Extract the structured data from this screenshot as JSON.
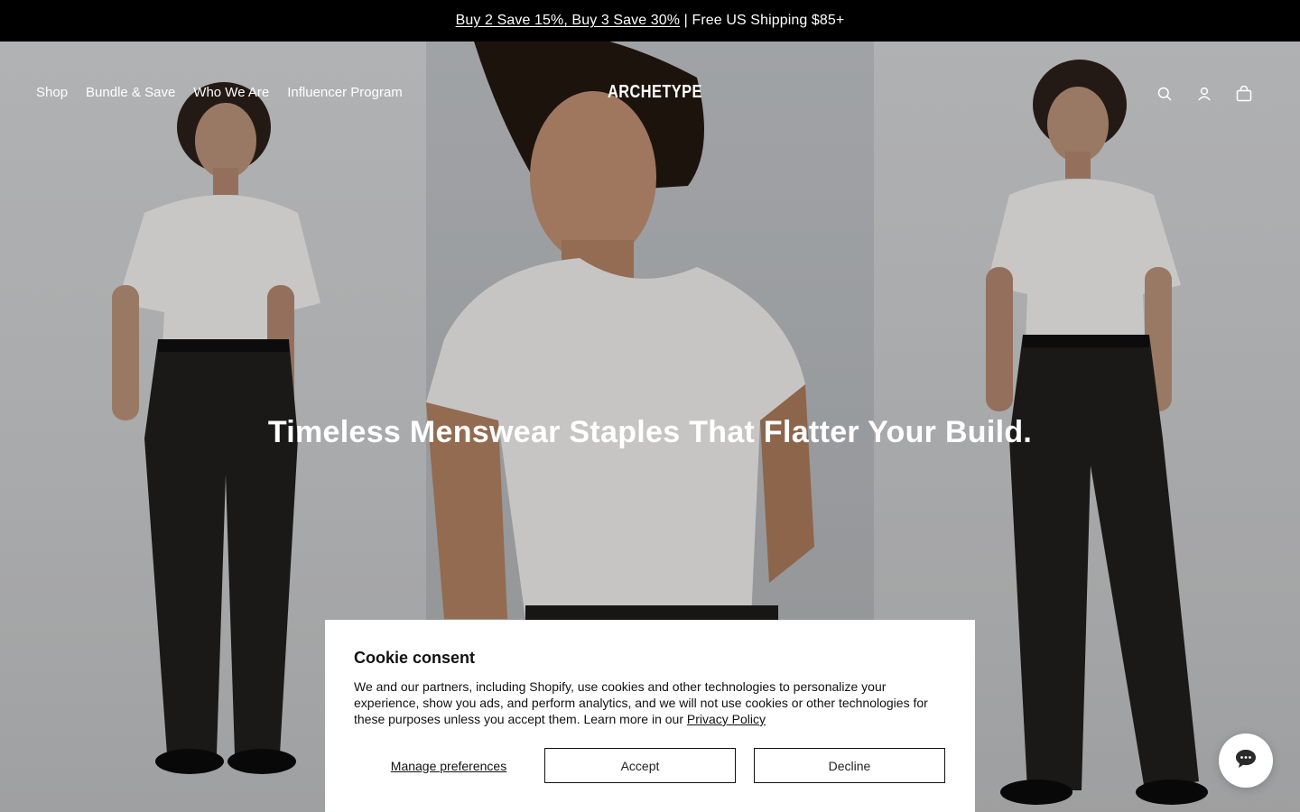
{
  "announcement": {
    "promo_link": "Buy 2 Save 15%, Buy 3 Save 30%",
    "separator": " | ",
    "shipping": "Free US Shipping $85+"
  },
  "nav": {
    "items": [
      {
        "label": "Shop"
      },
      {
        "label": "Bundle & Save"
      },
      {
        "label": "Who We Are"
      },
      {
        "label": "Influencer Program"
      }
    ],
    "logo": "ARCHETYPE",
    "icons": [
      "search-icon",
      "account-icon",
      "cart-icon"
    ]
  },
  "hero": {
    "headline": "Timeless Menswear Staples That Flatter Your Build."
  },
  "cookie": {
    "title": "Cookie consent",
    "body": "We and our partners, including Shopify, use cookies and other technologies to personalize your experience, show you ads, and perform analytics, and we will not use cookies or other technologies for these purposes unless you accept them. Learn more in our ",
    "privacy_link": "Privacy Policy",
    "manage_label": "Manage preferences",
    "accept_label": "Accept",
    "decline_label": "Decline"
  },
  "chat": {
    "icon": "chat-bubble-icon"
  },
  "colors": {
    "announcement_bg": "#000000",
    "text_on_hero": "#ffffff",
    "cookie_bg": "#ffffff"
  }
}
